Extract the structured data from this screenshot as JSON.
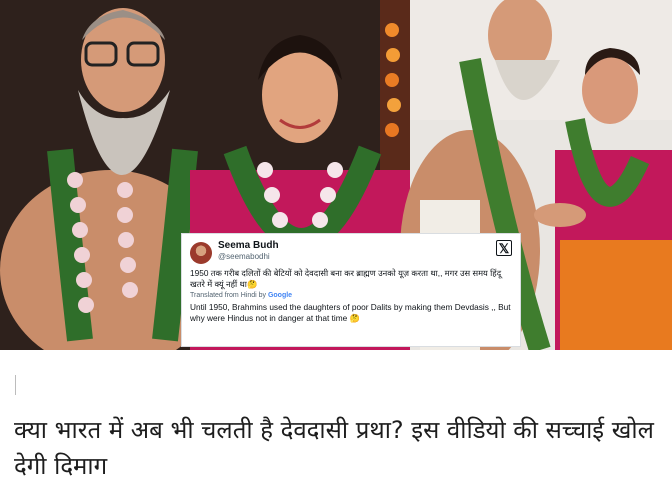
{
  "tweet": {
    "name": "Seema Budh",
    "handle": "@seemabodhi",
    "x_logo_icon": "x-logo-icon",
    "hindi_text": "1950 तक गरीब दलितों की बेटियों को देवदासी बना कर ब्राह्मण उनको यूज़ करता था,, मगर उस समय हिंदू खतरे में क्यूं नहीं था🤔",
    "translated_label": "Translated from Hindi by",
    "translator": "Google",
    "english_text": "Until 1950, Brahmins used the daughters of poor Dalits by making them Devdasis ,, But why were Hindus not in danger at that time 🤔"
  },
  "headline": "क्या भारत में अब भी चलती है देवदासी प्रथा? इस वीडियो की सच्चाई खोल देगी दिमाग"
}
